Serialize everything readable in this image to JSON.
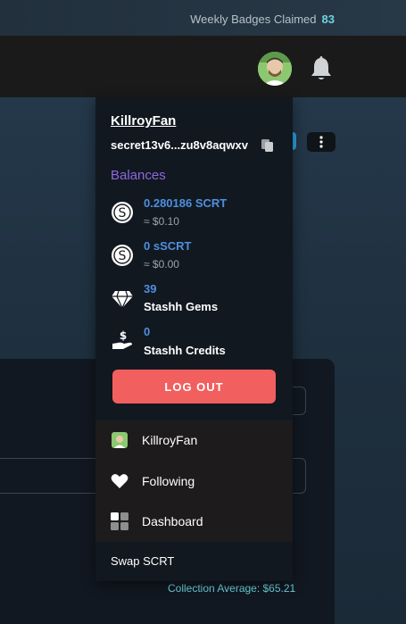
{
  "topbar": {
    "badges_label": "Weekly Badges Claimed",
    "badges_count": "83"
  },
  "account": {
    "username": "KillroyFan",
    "address": "secret13v6...zu8v8aqwxv"
  },
  "balances": {
    "title": "Balances",
    "scrt": {
      "value": "0.280186 SCRT",
      "usd": "≈ $0.10"
    },
    "sscrt": {
      "value": "0 sSCRT",
      "usd": "≈ $0.00"
    },
    "gems": {
      "value": "39",
      "label": "Stashh Gems"
    },
    "credits": {
      "value": "0",
      "label": "Stashh Credits"
    }
  },
  "logout_label": "LOG OUT",
  "menu": [
    {
      "label": "KillroyFan",
      "icon": "avatar-icon"
    },
    {
      "label": "Following",
      "icon": "heart-icon"
    },
    {
      "label": "Dashboard",
      "icon": "dashboard-icon"
    }
  ],
  "swap_label": "Swap SCRT",
  "collection_average": "Collection Average: $65.21",
  "colors": {
    "accent": "#6fd3e0",
    "logout": "#f25f5f",
    "balances_title": "#8f67e0",
    "value": "#4f8fe0"
  }
}
